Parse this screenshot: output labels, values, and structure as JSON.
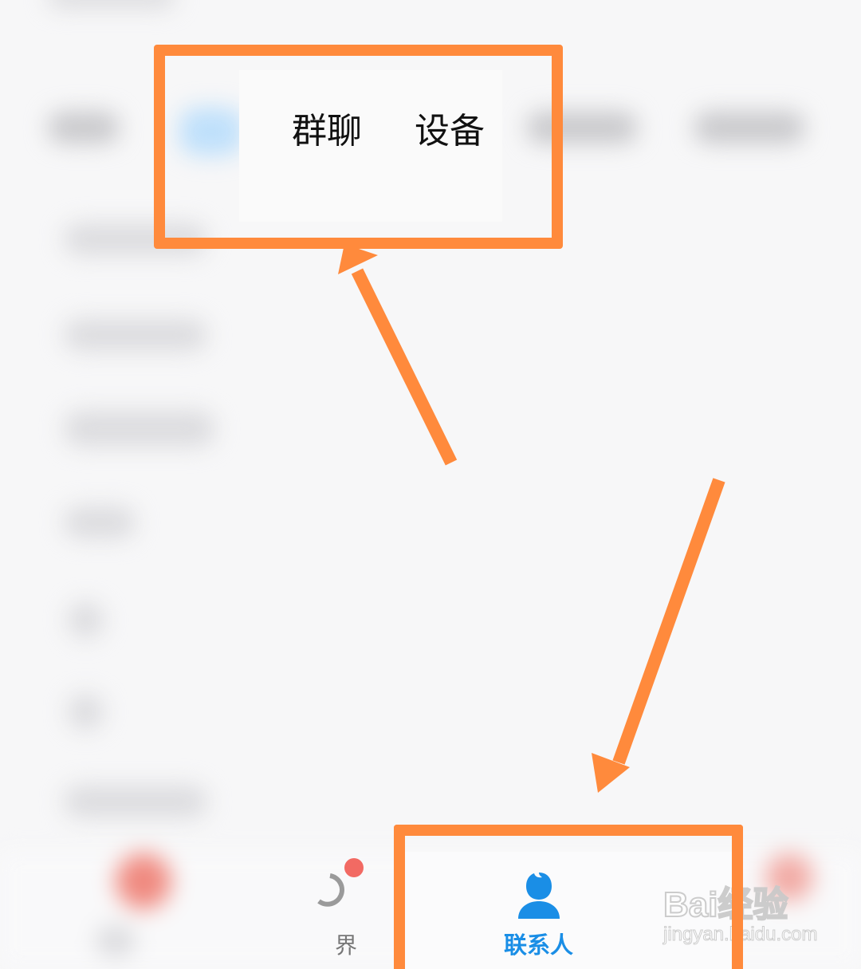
{
  "tabs": {
    "group_chat": "群聊",
    "devices": "设备"
  },
  "bottom_nav": {
    "partial_label": "界",
    "contacts_label": "联系人"
  },
  "watermark": {
    "brand": "Bai经验",
    "url": "jingyan.baidu.com"
  },
  "colors": {
    "annotation": "#ff8a3c",
    "contacts_active": "#1a8ee6",
    "badge": "#f26a63"
  },
  "icons": {
    "contacts": "person-icon",
    "world": "world-icon"
  }
}
